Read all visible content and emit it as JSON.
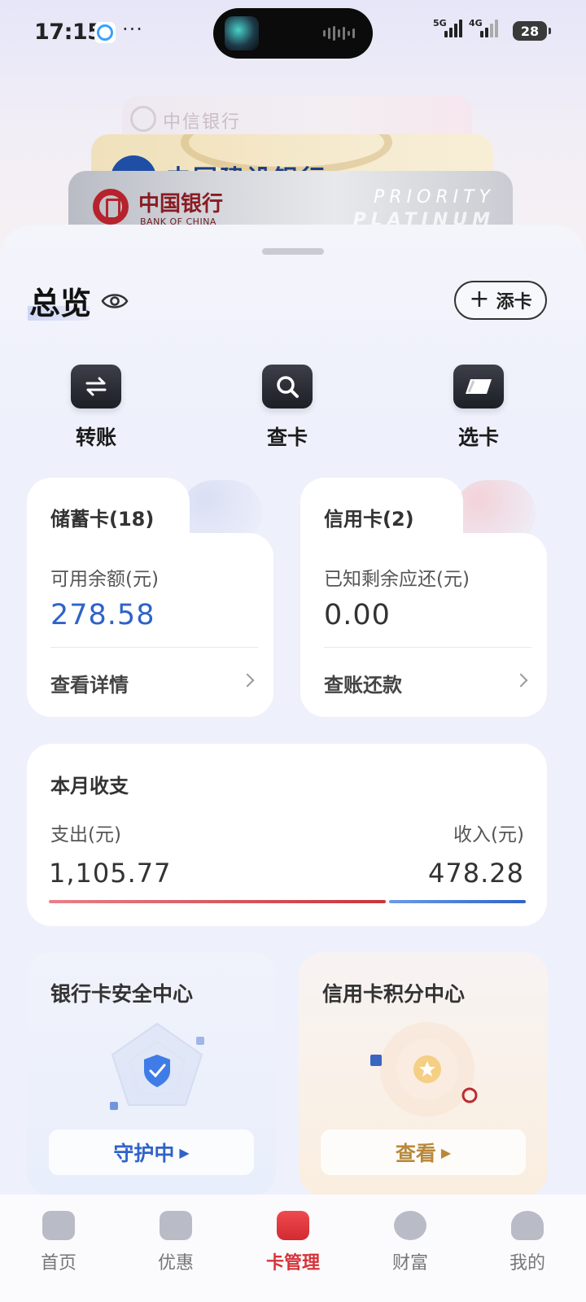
{
  "status_bar": {
    "time": "17:15",
    "more": "···",
    "signal_1_label": "5G",
    "signal_2_label": "4G",
    "battery": "28"
  },
  "cards_stack": {
    "back_card_name": "中信银行",
    "middle_card_name": "中国建设银行",
    "front_card_name": "中国银行",
    "front_card_sub": "BANK OF CHINA",
    "front_card_tier_1": "PRIORITY",
    "front_card_tier_2": "PLATINUM"
  },
  "header": {
    "title": "总览",
    "add_card_label": "添卡"
  },
  "quick_actions": [
    {
      "label": "转账",
      "icon": "transfer-icon"
    },
    {
      "label": "查卡",
      "icon": "search-icon"
    },
    {
      "label": "选卡",
      "icon": "card-select-icon"
    }
  ],
  "debit": {
    "title": "储蓄卡(18)",
    "balance_label": "可用余额(元)",
    "balance": "278.58",
    "link": "查看详情"
  },
  "credit": {
    "title": "信用卡(2)",
    "due_label": "已知剩余应还(元)",
    "due": "0.00",
    "link": "查账还款"
  },
  "monthly": {
    "title": "本月收支",
    "expense_label": "支出(元)",
    "income_label": "收入(元)",
    "expense": "1,105.77",
    "income": "478.28"
  },
  "security": {
    "title": "银行卡安全中心",
    "button": "守护中"
  },
  "points": {
    "title": "信用卡积分中心",
    "button": "查看"
  },
  "bottom_nav": [
    {
      "label": "首页",
      "icon": "home-icon"
    },
    {
      "label": "优惠",
      "icon": "coupon-icon"
    },
    {
      "label": "卡管理",
      "icon": "card-manage-icon"
    },
    {
      "label": "财富",
      "icon": "wealth-icon"
    },
    {
      "label": "我的",
      "icon": "profile-icon"
    }
  ],
  "colors": {
    "accent_blue": "#2f63c7",
    "accent_red": "#d6333a",
    "gold": "#b8893a"
  }
}
